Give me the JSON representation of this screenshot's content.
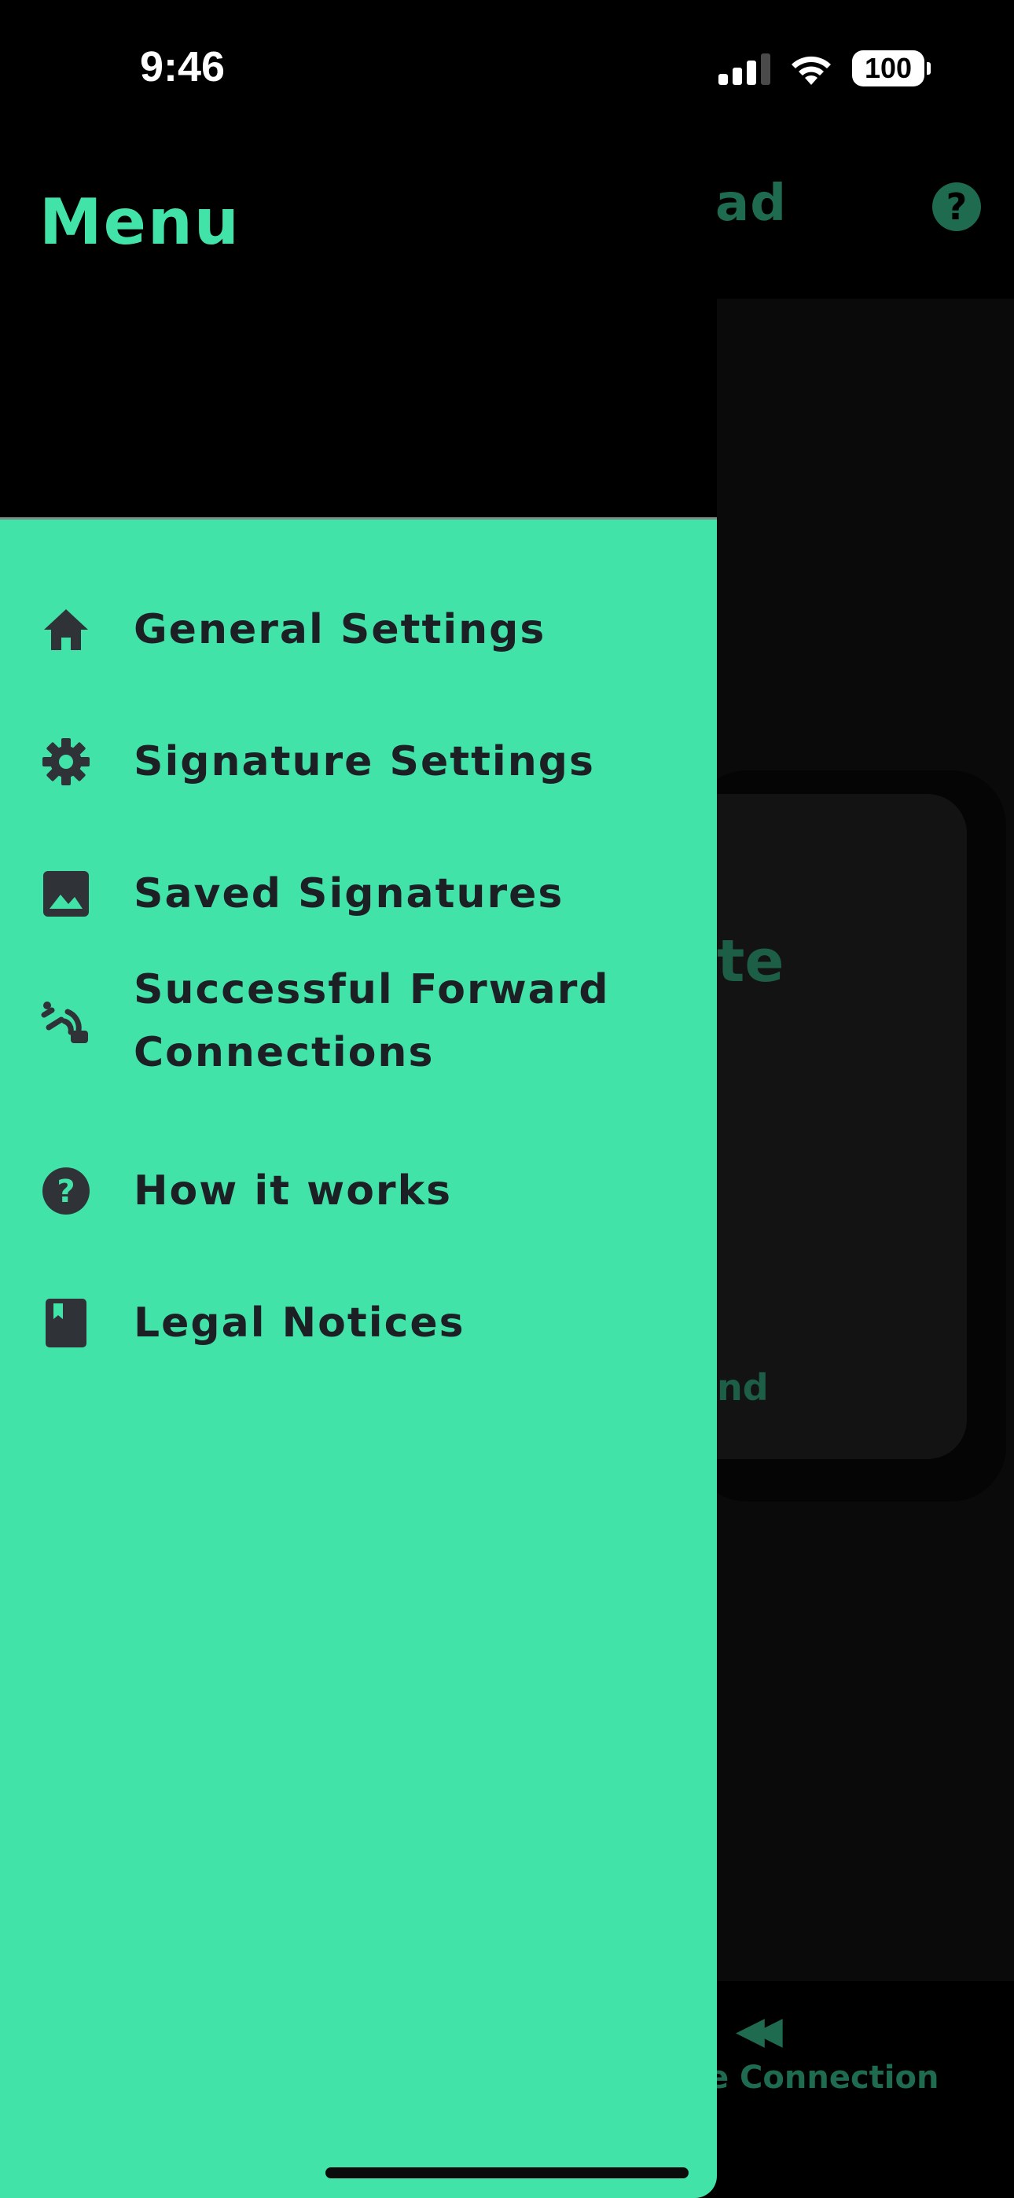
{
  "status_bar": {
    "time": "9:46",
    "battery": "100"
  },
  "background_app": {
    "header_title_fragment": "ad",
    "help_glyph": "?",
    "card_title_fragment": "te",
    "card_footer_fragment": "nd",
    "tab_label_fragment": "e Connection",
    "tab_icon": "rewind-icon"
  },
  "drawer": {
    "title": "Menu",
    "items": [
      {
        "label": "General Settings",
        "icon": "home-icon"
      },
      {
        "label": "Signature Settings",
        "icon": "gear-icon"
      },
      {
        "label": "Saved Signatures",
        "icon": "image-icon"
      },
      {
        "label": "Successful Forward Connections",
        "icon": "connection-icon"
      },
      {
        "label": "How it works",
        "icon": "help-circle-icon"
      },
      {
        "label": "Legal Notices",
        "icon": "book-icon"
      }
    ]
  },
  "colors": {
    "accent": "#42e3a8",
    "menu_text": "#1c1f24",
    "icon": "#2f3338",
    "dimmed_accent": "#1f6b4f"
  }
}
